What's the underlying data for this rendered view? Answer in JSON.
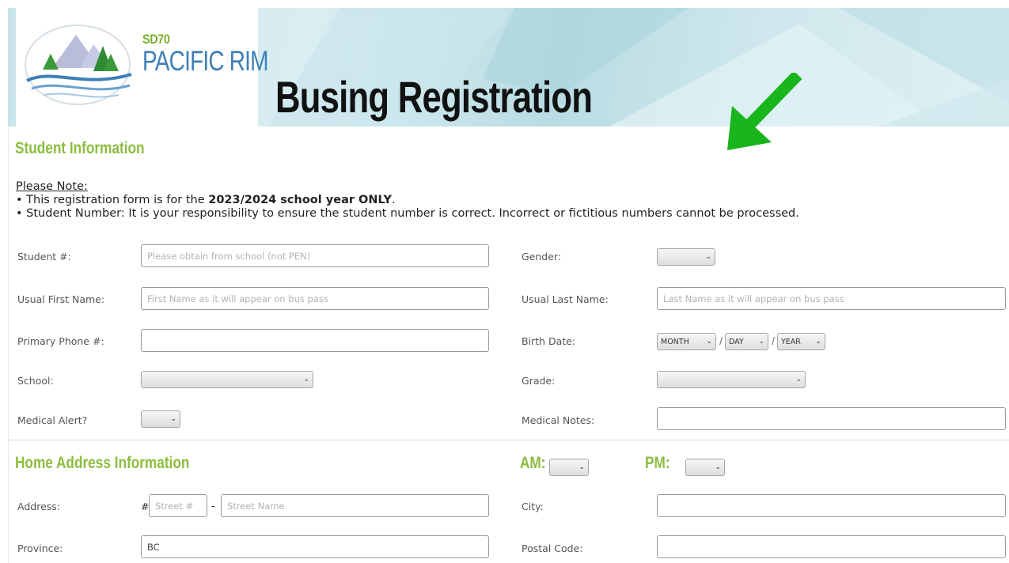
{
  "header": {
    "logo_sd": "SD70",
    "logo_name": "PACIFIC RIM",
    "title": "Busing Registration"
  },
  "student_section": {
    "title": "Student Information",
    "note_heading": "Please Note:",
    "note_line1_prefix": "• This registration form is for the ",
    "note_line1_bold": "2023/2024 school year ONLY",
    "note_line1_suffix": ".",
    "note_line2": "• Student Number: It is your responsibility to ensure the student number is correct. Incorrect or fictitious numbers cannot be processed."
  },
  "fields": {
    "student_number": {
      "label": "Student #:",
      "placeholder": "Please obtain from school (not PEN)",
      "value": ""
    },
    "gender": {
      "label": "Gender:",
      "value": ""
    },
    "first_name": {
      "label": "Usual First Name:",
      "placeholder": "First Name as it will appear on bus pass",
      "value": ""
    },
    "last_name": {
      "label": "Usual Last Name:",
      "placeholder": "Last Name as it will appear on bus pass",
      "value": ""
    },
    "phone": {
      "label": "Primary Phone #:",
      "value": ""
    },
    "birth_date": {
      "label": "Birth Date:",
      "month": "MONTH",
      "day": "DAY",
      "year": "YEAR",
      "sep": "/"
    },
    "school": {
      "label": "School:",
      "value": ""
    },
    "grade": {
      "label": "Grade:",
      "value": ""
    },
    "medical_alert": {
      "label": "Medical Alert?",
      "value": ""
    },
    "medical_notes": {
      "label": "Medical Notes:",
      "value": ""
    }
  },
  "address_section": {
    "title": "Home Address Information",
    "am_label": "AM:",
    "pm_label": "PM:",
    "address_label": "Address:",
    "hash": "#",
    "dash": "-",
    "street_number_placeholder": "Street #",
    "street_name_placeholder": "Street Name",
    "city_label": "City:",
    "province_label": "Province:",
    "province_value": "BC",
    "postal_label": "Postal Code:"
  },
  "icons": {
    "select_chevron": "chevron-down-icon",
    "arrow": "arrow-down-left-icon"
  },
  "colors": {
    "section_title": "#8cbd3f",
    "logo_green": "#7bb02a",
    "logo_blue": "#3d7fb8",
    "arrow_green": "#19b51c"
  }
}
